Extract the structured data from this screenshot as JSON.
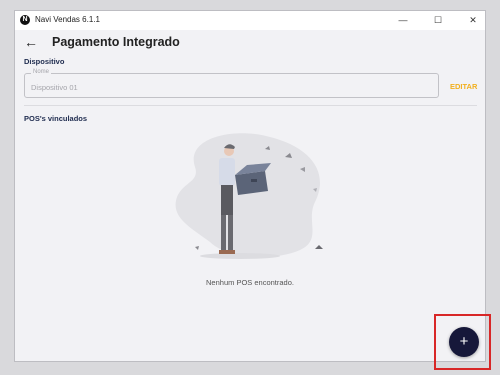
{
  "window": {
    "app_icon": "N",
    "title": "Navi Vendas 6.1.1",
    "minimize_glyph": "—",
    "maximize_glyph": "☐",
    "close_glyph": "✕"
  },
  "header": {
    "back_icon": "arrow-left-icon",
    "back_glyph": "←",
    "title": "Pagamento Integrado"
  },
  "device_section": {
    "label": "Dispositivo",
    "field_legend": "Nome",
    "field_value": "",
    "field_placeholder": "Dispositivo 01",
    "edit_label": "EDITAR"
  },
  "pos_section": {
    "label": "POS's vinculados",
    "empty_message": "Nenhum POS encontrado."
  },
  "fab": {
    "icon": "plus-icon",
    "glyph": "+"
  },
  "colors": {
    "accent": "#f2b01e",
    "fab_bg": "#16183a",
    "section_label": "#1f2c4f",
    "highlight": "#d82727"
  }
}
